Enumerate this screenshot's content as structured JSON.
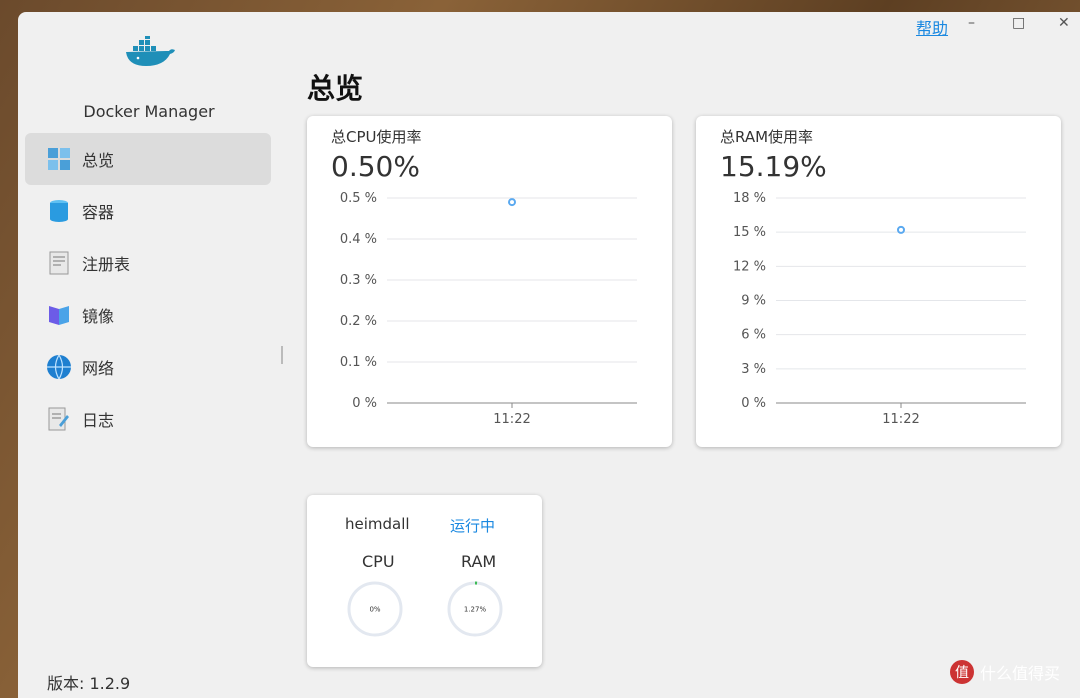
{
  "app": {
    "name": "Docker Manager",
    "version": "版本: 1.2.9"
  },
  "titlebar": {
    "help": "帮助",
    "minimize": "–",
    "maximize": "□",
    "close": "✕"
  },
  "sidebar": {
    "items": [
      {
        "label": "总览",
        "icon": "dashboard-icon",
        "active": true
      },
      {
        "label": "容器",
        "icon": "container-icon"
      },
      {
        "label": "注册表",
        "icon": "registry-icon"
      },
      {
        "label": "镜像",
        "icon": "image-icon"
      },
      {
        "label": "网络",
        "icon": "network-icon"
      },
      {
        "label": "日志",
        "icon": "log-icon"
      }
    ]
  },
  "main": {
    "title": "总览"
  },
  "cpu_card": {
    "title": "总CPU使用率",
    "value": "0.50%"
  },
  "ram_card": {
    "title": "总RAM使用率",
    "value": "15.19%"
  },
  "container": {
    "name": "heimdall",
    "status": "运行中",
    "cpu_label": "CPU",
    "ram_label": "RAM",
    "cpu_value": "0%",
    "ram_value": "1.27%",
    "cpu_fraction": 0.0,
    "ram_fraction": 0.0127
  },
  "watermark": {
    "text": "什么值得买",
    "logo": "值"
  },
  "colors": {
    "accent": "#1a88e0",
    "point": "#5aa9f0",
    "gauge_track": "#e3e8f0",
    "gauge_fill": "#3cba54"
  },
  "chart_data": [
    {
      "type": "scatter",
      "title": "总CPU使用率",
      "x": [
        "11:22"
      ],
      "values": [
        0.49
      ],
      "yticks": [
        "0 %",
        "0.1 %",
        "0.2 %",
        "0.3 %",
        "0.4 %",
        "0.5 %"
      ],
      "ylim": [
        0,
        0.5
      ],
      "grid": true
    },
    {
      "type": "scatter",
      "title": "总RAM使用率",
      "x": [
        "11:22"
      ],
      "values": [
        15.2
      ],
      "yticks": [
        "0 %",
        "3 %",
        "6 %",
        "9 %",
        "12 %",
        "15 %",
        "18 %"
      ],
      "ylim": [
        0,
        18
      ],
      "grid": true
    }
  ]
}
